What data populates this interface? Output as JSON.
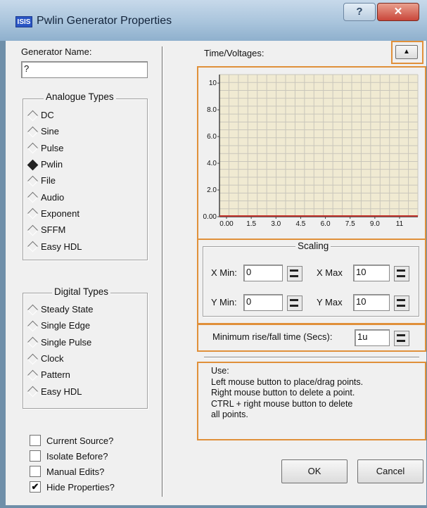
{
  "window": {
    "title": "Pwlin Generator Properties",
    "app_icon_text": "ISIS",
    "help_glyph": "?",
    "close_glyph": "✕"
  },
  "generator": {
    "name_label": "Generator Name:",
    "name_value": "?"
  },
  "analogue": {
    "title": "Analogue Types",
    "items": [
      {
        "label": "DC",
        "selected": false
      },
      {
        "label": "Sine",
        "selected": false
      },
      {
        "label": "Pulse",
        "selected": false
      },
      {
        "label": "Pwlin",
        "selected": true
      },
      {
        "label": "File",
        "selected": false
      },
      {
        "label": "Audio",
        "selected": false
      },
      {
        "label": "Exponent",
        "selected": false
      },
      {
        "label": "SFFM",
        "selected": false
      },
      {
        "label": "Easy HDL",
        "selected": false
      }
    ]
  },
  "digital": {
    "title": "Digital Types",
    "items": [
      {
        "label": "Steady State",
        "selected": false
      },
      {
        "label": "Single Edge",
        "selected": false
      },
      {
        "label": "Single Pulse",
        "selected": false
      },
      {
        "label": "Clock",
        "selected": false
      },
      {
        "label": "Pattern",
        "selected": false
      },
      {
        "label": "Easy HDL",
        "selected": false
      }
    ]
  },
  "options": [
    {
      "label": "Current Source?",
      "checked": false
    },
    {
      "label": "Isolate Before?",
      "checked": false
    },
    {
      "label": "Manual Edits?",
      "checked": false
    },
    {
      "label": "Hide Properties?",
      "checked": true
    }
  ],
  "timevolt": {
    "label": "Time/Voltages:",
    "expand_glyph": "▲"
  },
  "chart_data": {
    "type": "line",
    "x_ticks": [
      "0.00",
      "1.5",
      "3.0",
      "4.5",
      "6.0",
      "7.5",
      "9.0",
      "11"
    ],
    "y_ticks": [
      "0.00",
      "2.0",
      "4.0",
      "6.0",
      "8.0",
      "10"
    ],
    "xlim": [
      0,
      10
    ],
    "ylim": [
      0,
      10
    ],
    "grid": true,
    "series": [
      {
        "x": [
          0,
          10
        ],
        "y": [
          0,
          0
        ]
      }
    ],
    "colors": {
      "plot_bg": "#f0ead2",
      "grid": "#c9c6bb",
      "line": "#c0302a"
    }
  },
  "scaling": {
    "title": "Scaling",
    "xmin_label": "X Min:",
    "xmin_value": "0",
    "xmax_label": "X Max",
    "xmax_value": "10",
    "ymin_label": "Y Min:",
    "ymin_value": "0",
    "ymax_label": "Y Max",
    "ymax_value": "10"
  },
  "risefall": {
    "label": "Minimum rise/fall time (Secs):",
    "value": "1u"
  },
  "help_text": {
    "title": "Use:",
    "lines": [
      "Left mouse button to place/drag points.",
      "Right mouse button to delete a point.",
      "CTRL + right mouse button to delete",
      "all points."
    ]
  },
  "buttons": {
    "ok": "OK",
    "cancel": "Cancel"
  },
  "colors": {
    "highlight": "#e0903a",
    "window_frame": "#6f8fa9"
  }
}
